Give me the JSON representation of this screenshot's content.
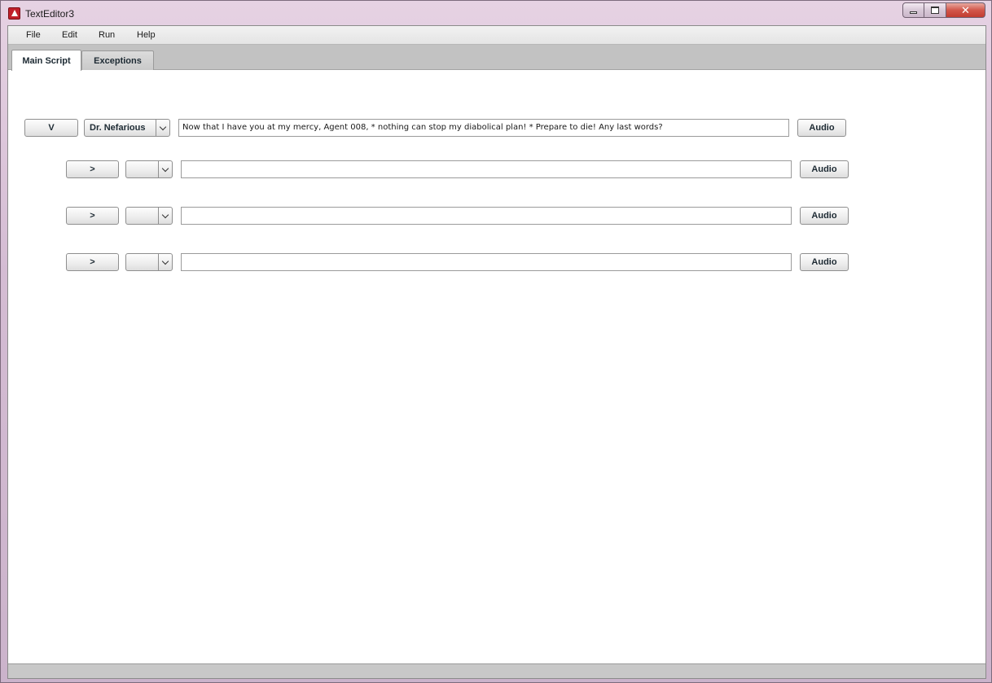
{
  "window": {
    "title": "TextEditor3",
    "close_glyph": "✕"
  },
  "menu": {
    "file": "File",
    "edit": "Edit",
    "run": "Run",
    "help": "Help"
  },
  "tabs": [
    {
      "label": "Main Script",
      "active": true
    },
    {
      "label": "Exceptions",
      "active": false
    }
  ],
  "rows": [
    {
      "toggle_label": "V",
      "speaker": "Dr. Nefarious",
      "line": "Now that I have you at my mercy, Agent 008, * nothing can stop my diabolical plan! * Prepare to die! Any last words?",
      "audio_label": "Audio"
    },
    {
      "toggle_label": ">",
      "speaker": "",
      "line": "",
      "audio_label": "Audio"
    },
    {
      "toggle_label": ">",
      "speaker": "",
      "line": "",
      "audio_label": "Audio"
    },
    {
      "toggle_label": ">",
      "speaker": "",
      "line": "",
      "audio_label": "Audio"
    }
  ],
  "icons": {
    "app": "app-icon",
    "minimize": "minimize-icon",
    "maximize": "maximize-icon",
    "close": "close-icon",
    "dropdown": "chevron-down-icon"
  }
}
